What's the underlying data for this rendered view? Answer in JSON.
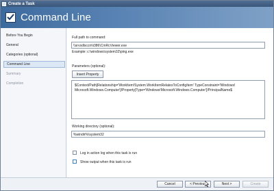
{
  "window": {
    "title": "Create a Task",
    "header_title": "Command Line"
  },
  "nav": {
    "items": [
      {
        "label": "Before You Begin",
        "state": "normal"
      },
      {
        "label": "General",
        "state": "normal"
      },
      {
        "label": "Categories (optional)",
        "state": "normal"
      },
      {
        "label": "Command Line",
        "state": "selected"
      },
      {
        "label": "Summary",
        "state": "muted"
      },
      {
        "label": "Completion",
        "state": "muted"
      }
    ]
  },
  "form": {
    "full_path_label": "Full path to command:",
    "full_path_value": "\\\\srvsdlsccm\\i386\\CmRcViewer.exe",
    "example_text": "Example: c:\\windows\\system32\\ping.exe",
    "parameters_label": "Parameters (optional):",
    "insert_property_label": "Insert Property",
    "parameters_value": "$Context/Path[Relationship='WorkItem!System.WorkItemRelatesToConfigItem' TypeConstraint='Windows! Microsoft.Windows.Computer']/Property[Type='Windows!Microsoft.Windows.Computer']/PrincipalName$",
    "working_dir_label": "Working directory (optional):",
    "working_dir_value": "%windir%\\system32",
    "log_checkbox_label": "Log in action log when this task is run",
    "output_checkbox_label": "Show output when this task is run",
    "log_checked": false,
    "output_checked": false
  },
  "footer": {
    "cancel_label": "Cancel",
    "previous_label": "< Previous",
    "next_label": "Next >",
    "create_label": "Create"
  },
  "colors": {
    "header_gradient_start": "#3d6a9e",
    "selected_nav_bg": "#dce8f6",
    "window_bg": "#f4f6f9"
  }
}
